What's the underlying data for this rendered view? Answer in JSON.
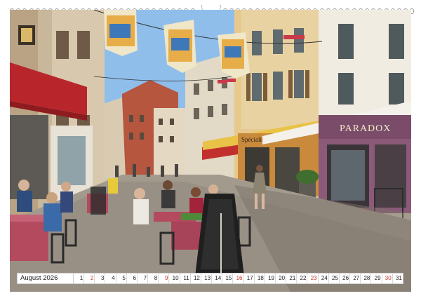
{
  "calendar": {
    "month_label": "August 2026",
    "days": [
      {
        "n": "1",
        "sunday": false
      },
      {
        "n": "2",
        "sunday": true
      },
      {
        "n": "3",
        "sunday": false
      },
      {
        "n": "4",
        "sunday": false
      },
      {
        "n": "5",
        "sunday": false
      },
      {
        "n": "6",
        "sunday": false
      },
      {
        "n": "7",
        "sunday": false
      },
      {
        "n": "8",
        "sunday": false
      },
      {
        "n": "9",
        "sunday": true
      },
      {
        "n": "10",
        "sunday": false
      },
      {
        "n": "11",
        "sunday": false
      },
      {
        "n": "12",
        "sunday": false
      },
      {
        "n": "13",
        "sunday": false
      },
      {
        "n": "14",
        "sunday": false
      },
      {
        "n": "15",
        "sunday": false
      },
      {
        "n": "16",
        "sunday": true
      },
      {
        "n": "17",
        "sunday": false
      },
      {
        "n": "18",
        "sunday": false
      },
      {
        "n": "19",
        "sunday": false
      },
      {
        "n": "20",
        "sunday": false
      },
      {
        "n": "21",
        "sunday": false
      },
      {
        "n": "22",
        "sunday": false
      },
      {
        "n": "23",
        "sunday": true
      },
      {
        "n": "24",
        "sunday": false
      },
      {
        "n": "25",
        "sunday": false
      },
      {
        "n": "26",
        "sunday": false
      },
      {
        "n": "27",
        "sunday": false
      },
      {
        "n": "28",
        "sunday": false
      },
      {
        "n": "29",
        "sunday": false
      },
      {
        "n": "30",
        "sunday": true
      },
      {
        "n": "31",
        "sunday": false
      }
    ]
  },
  "photo": {
    "shop_sign": "PARADOX",
    "cafe_sign": "Spécialités",
    "colors": {
      "sky": "#7fb4e6",
      "left_building": "#c9b79c",
      "right_building": "#f1ece2",
      "paradox_facade": "#8a5a78",
      "awning_red": "#b8262c",
      "awning_yellow": "#e9c347",
      "pavement": "#a39a8e",
      "tablecloth": "#b34a5e"
    }
  }
}
